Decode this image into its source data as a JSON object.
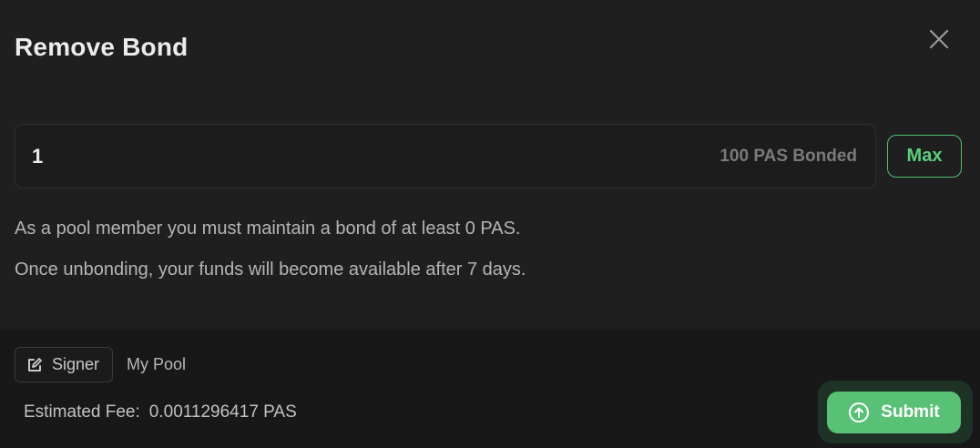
{
  "modal": {
    "title": "Remove Bond",
    "close_icon": "close-icon"
  },
  "amount": {
    "value": "1",
    "bonded_label": "100 PAS Bonded",
    "max_label": "Max"
  },
  "notes": [
    "As a pool member you must maintain a bond of at least 0 PAS.",
    "Once unbonding, your funds will become available after 7 days."
  ],
  "footer": {
    "signer_label": "Signer",
    "signer_icon": "edit-icon",
    "pool_label": "My Pool",
    "fee_label": "Estimated Fee:",
    "fee_value": "0.0011296417 PAS",
    "submit_label": "Submit",
    "submit_icon": "arrow-up-circle-icon"
  },
  "colors": {
    "accent": "#58c176",
    "background": "#1f1f1f",
    "footer_background": "#181818"
  }
}
